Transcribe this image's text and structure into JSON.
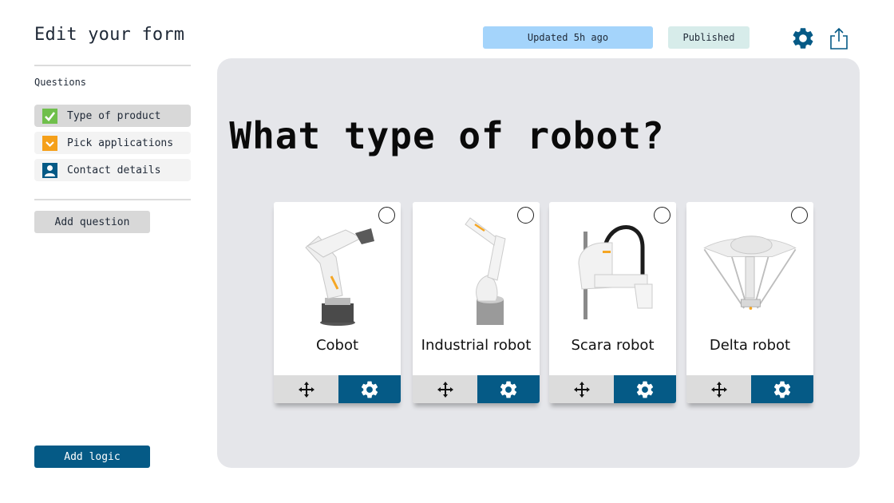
{
  "header": {
    "title": "Edit your form",
    "updated_badge": "Updated 5h ago",
    "status_badge": "Published",
    "settings_icon": "gear-icon",
    "share_icon": "share-icon"
  },
  "sidebar": {
    "section_label": "Questions",
    "items": [
      {
        "label": "Type of product",
        "icon": "checkbox-icon",
        "icon_color": "#6fbf4b",
        "active": true
      },
      {
        "label": "Pick applications",
        "icon": "chevron-down-icon",
        "icon_color": "#f5a01a",
        "active": false
      },
      {
        "label": "Contact details",
        "icon": "user-icon",
        "icon_color": "#055a86",
        "active": false
      }
    ],
    "add_question_label": "Add question",
    "add_logic_label": "Add logic"
  },
  "main": {
    "question": "What type of robot?",
    "options": [
      {
        "label": "Cobot",
        "image": "cobot-image",
        "selected": false
      },
      {
        "label": "Industrial robot",
        "image": "industrial-robot-image",
        "selected": false
      },
      {
        "label": "Scara robot",
        "image": "scara-robot-image",
        "selected": false
      },
      {
        "label": "Delta robot",
        "image": "delta-robot-image",
        "selected": false
      }
    ],
    "move_icon": "move-icon",
    "config_icon": "gear-icon"
  },
  "colors": {
    "primary": "#055a86",
    "updated_badge_bg": "#a4d4fb",
    "published_badge_bg": "#d7ecea",
    "canvas_bg": "#e5e6ea",
    "robot_accent": "#f5a623"
  }
}
